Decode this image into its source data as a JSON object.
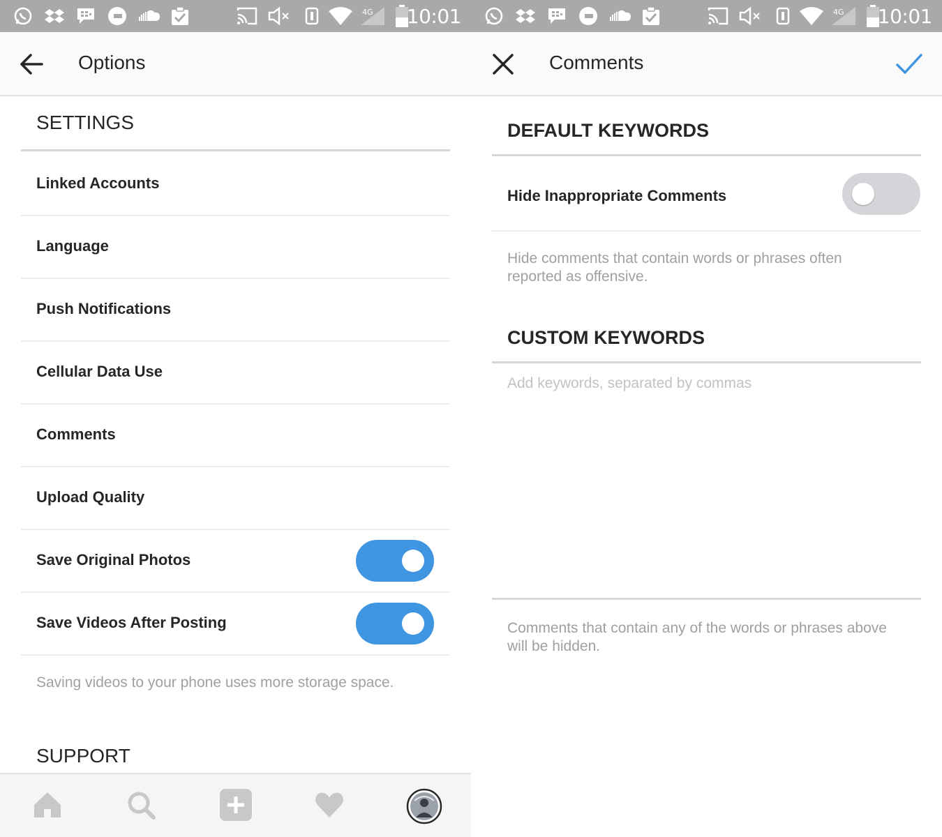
{
  "status_bar": {
    "time": "10:01",
    "network": "4G",
    "icons": [
      "whatsapp-icon",
      "dropbox-icon",
      "bbm-icon",
      "uber-icon",
      "soundcloud-icon",
      "clipboard-check-icon",
      "cast-icon",
      "volume-mute-icon",
      "vibrate-icon",
      "wifi-icon",
      "cell-signal-icon",
      "battery-icon"
    ]
  },
  "options": {
    "title": "Options",
    "settings_heading": "SETTINGS",
    "items": [
      {
        "label": "Linked Accounts"
      },
      {
        "label": "Language"
      },
      {
        "label": "Push Notifications"
      },
      {
        "label": "Cellular Data Use"
      },
      {
        "label": "Comments"
      },
      {
        "label": "Upload Quality"
      },
      {
        "label": "Save Original Photos",
        "toggle": true
      },
      {
        "label": "Save Videos After Posting",
        "toggle": true
      }
    ],
    "save_videos_help": "Saving videos to your phone uses more storage space.",
    "support_heading": "SUPPORT"
  },
  "bottom_nav": {
    "items": [
      "home-icon",
      "search-icon",
      "add-post-icon",
      "heart-icon",
      "profile-avatar"
    ]
  },
  "comments": {
    "title": "Comments",
    "default_heading": "DEFAULT KEYWORDS",
    "hide_label": "Hide Inappropriate Comments",
    "hide_toggle": false,
    "hide_help": "Hide comments that contain words or phrases often reported as offensive.",
    "custom_heading": "CUSTOM KEYWORDS",
    "keywords_placeholder": "Add keywords, separated by commas",
    "keywords_value": "",
    "custom_help": "Comments that contain any of the words or phrases above will be hidden."
  },
  "colors": {
    "accent": "#3f95e0",
    "status_bar": "#a9a9a9",
    "toggle_off": "#d3d5d8",
    "help_text": "#a0a0a0"
  }
}
